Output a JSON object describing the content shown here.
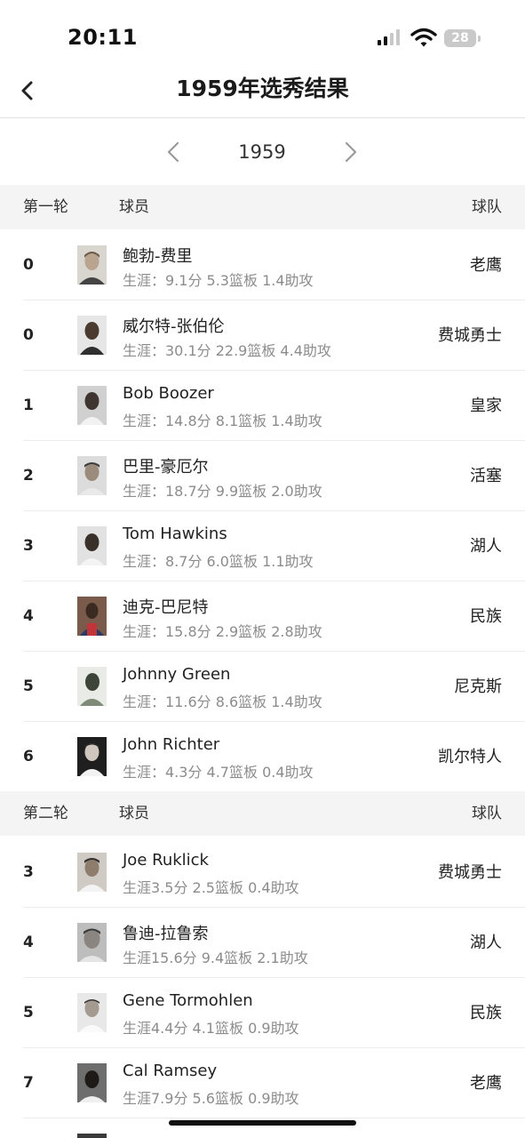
{
  "status": {
    "time": "20:11",
    "battery": "28"
  },
  "header": {
    "title": "1959年选秀结果"
  },
  "year_selector": {
    "year": "1959"
  },
  "sections": [
    {
      "round_label": "第一轮",
      "player_label": "球员",
      "team_label": "球队",
      "picks": [
        {
          "pick": "0",
          "name": "鲍勃-费里",
          "stats": "生涯：9.1分 5.3篮板 1.4助攻",
          "team": "老鹰"
        },
        {
          "pick": "0",
          "name": "威尔特-张伯伦",
          "stats": "生涯：30.1分 22.9篮板 4.4助攻",
          "team": "费城勇士"
        },
        {
          "pick": "1",
          "name": "Bob Boozer",
          "stats": "生涯：14.8分 8.1篮板 1.4助攻",
          "team": "皇家"
        },
        {
          "pick": "2",
          "name": "巴里-豪厄尔",
          "stats": "生涯：18.7分 9.9篮板 2.0助攻",
          "team": "活塞"
        },
        {
          "pick": "3",
          "name": "Tom Hawkins",
          "stats": "生涯：8.7分 6.0篮板 1.1助攻",
          "team": "湖人"
        },
        {
          "pick": "4",
          "name": "迪克-巴尼特",
          "stats": "生涯：15.8分 2.9篮板 2.8助攻",
          "team": "民族"
        },
        {
          "pick": "5",
          "name": "Johnny Green",
          "stats": "生涯：11.6分 8.6篮板 1.4助攻",
          "team": "尼克斯"
        },
        {
          "pick": "6",
          "name": "John Richter",
          "stats": "生涯：4.3分 4.7篮板 0.4助攻",
          "team": "凯尔特人"
        }
      ]
    },
    {
      "round_label": "第二轮",
      "player_label": "球员",
      "team_label": "球队",
      "picks": [
        {
          "pick": "3",
          "name": "Joe Ruklick",
          "stats": "生涯3.5分 2.5篮板 0.4助攻",
          "team": "费城勇士"
        },
        {
          "pick": "4",
          "name": "鲁迪-拉鲁索",
          "stats": "生涯15.6分 9.4篮板 2.1助攻",
          "team": "湖人"
        },
        {
          "pick": "5",
          "name": "Gene Tormohlen",
          "stats": "生涯4.4分 4.1篮板 0.9助攻",
          "team": "民族"
        },
        {
          "pick": "7",
          "name": "Cal Ramsey",
          "stats": "生涯7.9分 5.6篮板 0.9助攻",
          "team": "老鹰"
        }
      ]
    }
  ]
}
